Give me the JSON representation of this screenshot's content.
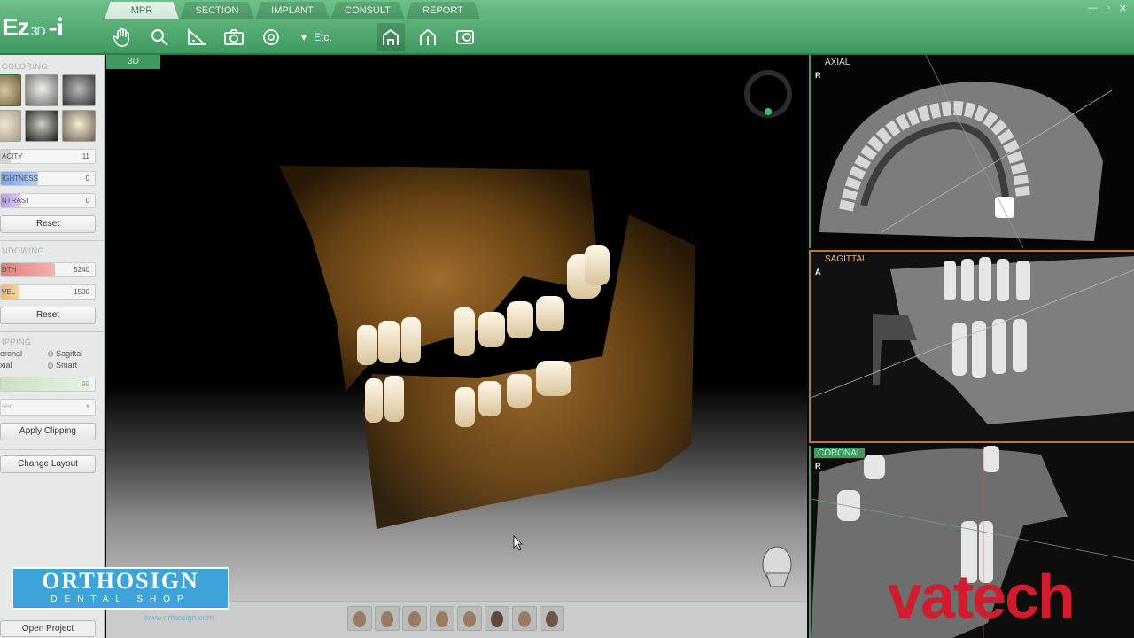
{
  "app": {
    "logo": "Ez",
    "logo_sub": "3D",
    "logo_i": "-i"
  },
  "tabs": [
    {
      "label": "MPR",
      "active": true
    },
    {
      "label": "SECTION",
      "active": false
    },
    {
      "label": "IMPLANT",
      "active": false
    },
    {
      "label": "CONSULT",
      "active": false
    },
    {
      "label": "REPORT",
      "active": false
    }
  ],
  "toolbar": {
    "etc_label": "Etc.",
    "tools": [
      "hand-icon",
      "zoom-icon",
      "measure-icon",
      "camera-icon",
      "reset-view-icon",
      "tooth-view-icon",
      "tooth-view-2-icon",
      "capture-icon"
    ]
  },
  "left_panel": {
    "coloring_title": "COLORING",
    "opacity": {
      "label": "ACITY",
      "value": "11",
      "fill": 0.1
    },
    "brightness": {
      "label": "IGHTNESS",
      "value": "0",
      "fill": 0.4
    },
    "contrast": {
      "label": "NTRAST",
      "value": "0",
      "fill": 0.2
    },
    "reset1": "Reset",
    "windowing_title": "NDOWING",
    "width": {
      "label": "DTH",
      "value": "5240",
      "fill": 0.58
    },
    "level": {
      "label": "VEL",
      "value": "1500",
      "fill": 0.2
    },
    "reset2": "Reset",
    "clipping_title": "IPPING",
    "radio": {
      "coronal": "oronal",
      "sagittal": "Sagittal",
      "axial": "xial",
      "smart": "Smart"
    },
    "clip_value": "99",
    "clip_select": "ser",
    "apply_clipping": "Apply Clipping",
    "change_layout": "Change Layout",
    "open_project": "Open Project"
  },
  "view3d": {
    "label": "3D"
  },
  "panels": {
    "axial": {
      "name": "AXIAL",
      "orient": "R"
    },
    "sagittal": {
      "name": "SAGITTAL",
      "orient": "A"
    },
    "coronal": {
      "name": "CORONAL",
      "orient": "R"
    }
  },
  "watermarks": {
    "orthosign_big": "ORTHOSIGN",
    "orthosign_small": "DENTAL SHOP",
    "orthosign_url": "www.orthosign.com",
    "vatech": "vatech"
  },
  "colors": {
    "accent": "#3e9a5f",
    "sagittal_border": "#b47a3a",
    "vatech_red": "#d01c2c",
    "orthosign_blue": "#3da3d8"
  }
}
